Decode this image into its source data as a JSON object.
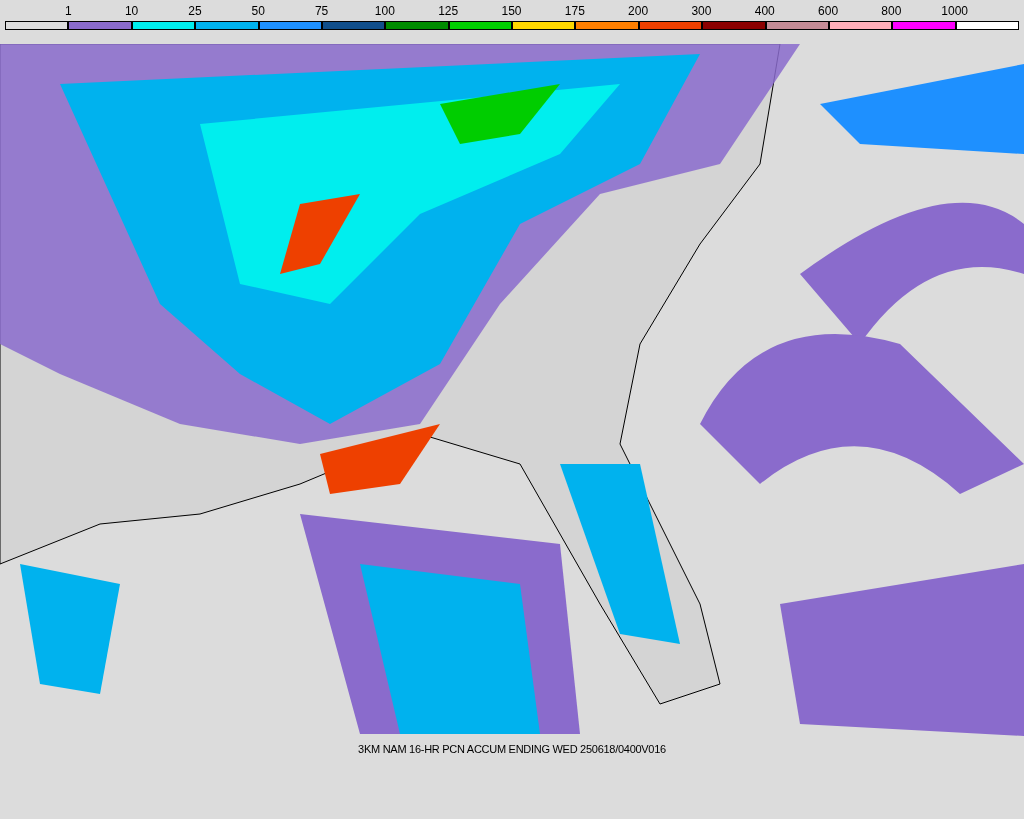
{
  "legend": [
    {
      "color": "#dcdcdc",
      "label": "1"
    },
    {
      "color": "#8a6bcc",
      "label": "10"
    },
    {
      "color": "#00eeee",
      "label": "25"
    },
    {
      "color": "#00b2ee",
      "label": "50"
    },
    {
      "color": "#1e90ff",
      "label": "75"
    },
    {
      "color": "#104e8b",
      "label": "100"
    },
    {
      "color": "#008b00",
      "label": "125"
    },
    {
      "color": "#00cd00",
      "label": "150"
    },
    {
      "color": "#ffd700",
      "label": "175"
    },
    {
      "color": "#ff7f00",
      "label": "200"
    },
    {
      "color": "#ee4000",
      "label": "300"
    },
    {
      "color": "#8b0000",
      "label": "400"
    },
    {
      "color": "#c48c96",
      "label": "600"
    },
    {
      "color": "#ffaeb9",
      "label": "800"
    },
    {
      "color": "#ff00ff",
      "label": "1000"
    },
    {
      "color": "#ffffff"
    }
  ],
  "caption": "3KM NAM 16-HR PCN ACCUM ENDING WED 250618/0400V016"
}
